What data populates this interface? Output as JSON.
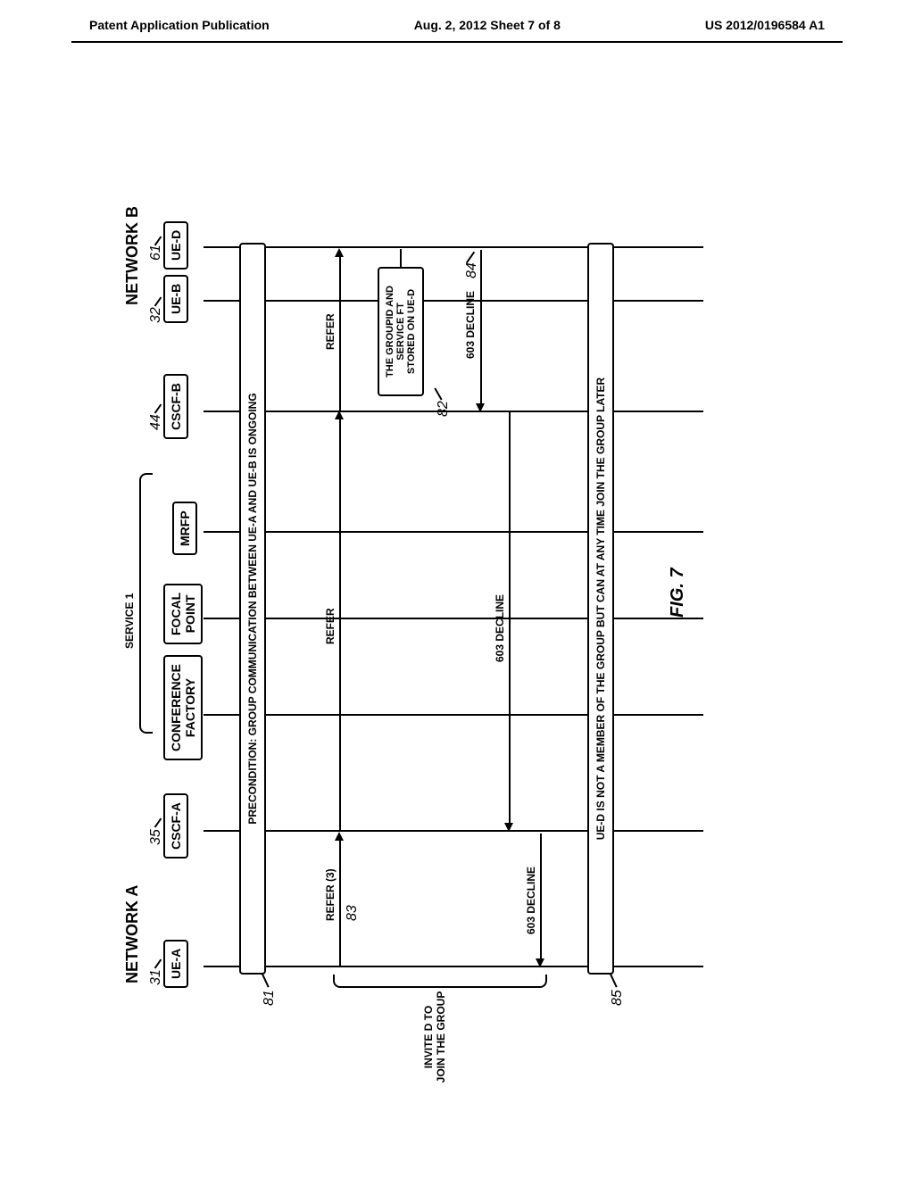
{
  "header": {
    "left": "Patent Application Publication",
    "center": "Aug. 2, 2012  Sheet 7 of 8",
    "right": "US 2012/0196584 A1"
  },
  "networks": {
    "a": "NETWORK A",
    "b": "NETWORK B"
  },
  "entities": {
    "ue_a": "UE-A",
    "cscf_a": "CSCF-A",
    "conference_factory": "CONFERENCE\nFACTORY",
    "focal_point": "FOCAL\nPOINT",
    "mrfp": "MRFP",
    "cscf_b": "CSCF-B",
    "ue_b": "UE-B",
    "ue_d": "UE-D"
  },
  "refs": {
    "r31": "31",
    "r35": "35",
    "r44": "44",
    "r32": "32",
    "r61": "61",
    "r81": "81",
    "r82": "82",
    "r83": "83",
    "r84": "84",
    "r85": "85"
  },
  "service_label": "SERVICE 1",
  "events": {
    "precondition": "PRECONDITION: GROUP COMMUNICATION BETWEEN UE-A AND UE-B IS ONGOING",
    "groupid": "THE GROUPID AND\nSERVICE FT\nSTORED ON UE-D",
    "result": "UE-D IS NOT A MEMBER OF THE GROUP BUT CAN AT ANY TIME JOIN THE GROUP LATER"
  },
  "messages": {
    "refer3": "REFER (3)",
    "refer": "REFER",
    "decline": "603 DECLINE"
  },
  "side": {
    "invite": "INVITE D TO\nJOIN THE GROUP"
  },
  "figure": "FIG. 7"
}
